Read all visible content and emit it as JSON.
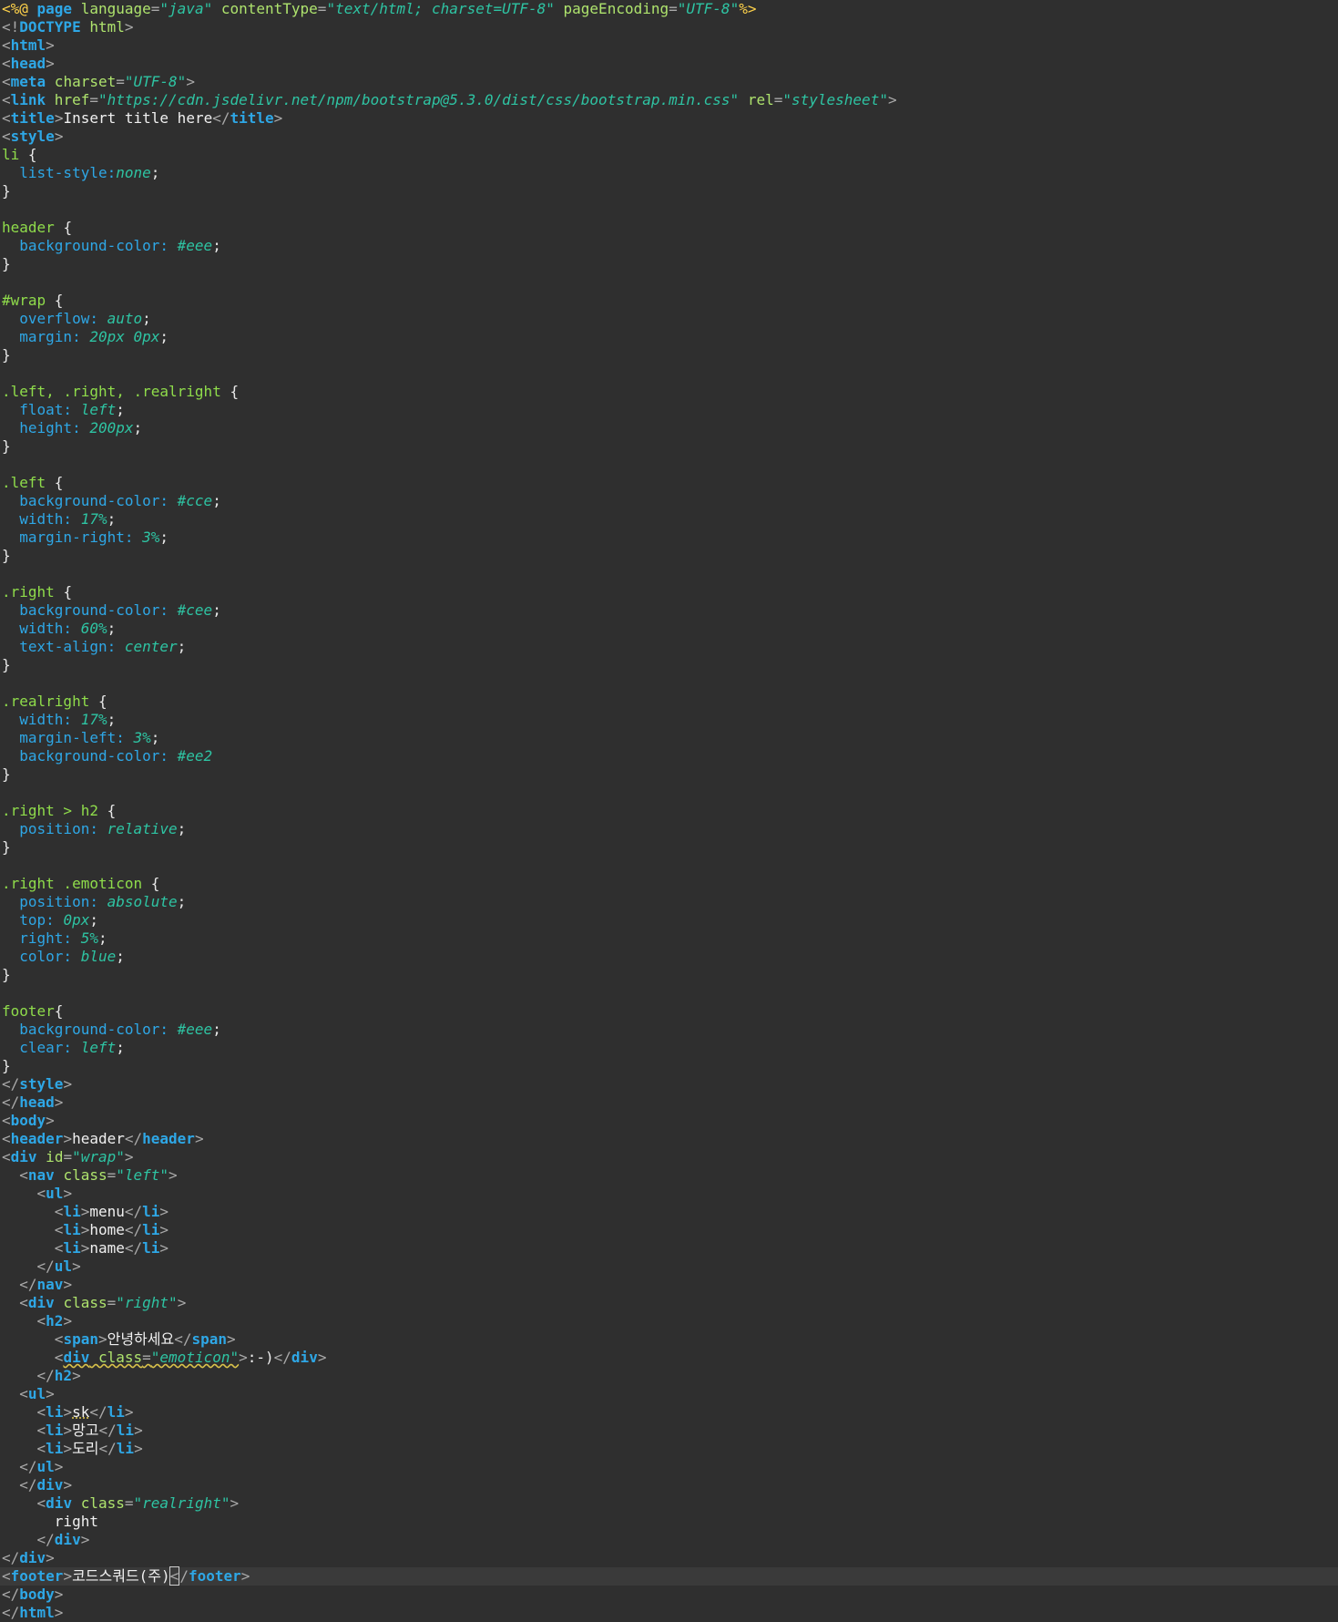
{
  "editor": {
    "colors": {
      "background": "#2f2f2f",
      "current_line": "#3a3a3a",
      "tag": "#2ea7e6",
      "attribute": "#aee36d",
      "string": "#2ec4a3",
      "directive": "#ffd24a",
      "selector": "#8fdc4b",
      "text": "#e8e8e8"
    },
    "current_line_index": 86,
    "lines": [
      [
        [
          "dir",
          "<%@ "
        ],
        [
          "tag",
          "page"
        ],
        [
          "attr",
          " language"
        ],
        [
          "punct",
          "="
        ],
        [
          "str",
          "\"java\""
        ],
        [
          "attr",
          " contentType"
        ],
        [
          "punct",
          "="
        ],
        [
          "str",
          "\"text/html; charset=UTF-8\""
        ],
        [
          "attr",
          " pageEncoding"
        ],
        [
          "punct",
          "="
        ],
        [
          "str",
          "\"UTF-8\""
        ],
        [
          "dir",
          "%>"
        ]
      ],
      [
        [
          "punct",
          "<!"
        ],
        [
          "tag",
          "DOCTYPE"
        ],
        [
          "attr",
          " html"
        ],
        [
          "punct",
          ">"
        ]
      ],
      [
        [
          "punct",
          "<"
        ],
        [
          "tag",
          "html"
        ],
        [
          "punct",
          ">"
        ]
      ],
      [
        [
          "punct",
          "<"
        ],
        [
          "tag",
          "head"
        ],
        [
          "punct",
          ">"
        ]
      ],
      [
        [
          "punct",
          "<"
        ],
        [
          "tag",
          "meta"
        ],
        [
          "attr",
          " charset"
        ],
        [
          "punct",
          "="
        ],
        [
          "str",
          "\"UTF-8\""
        ],
        [
          "punct",
          ">"
        ]
      ],
      [
        [
          "punct",
          "<"
        ],
        [
          "tag",
          "link"
        ],
        [
          "attr",
          " href"
        ],
        [
          "punct",
          "="
        ],
        [
          "str",
          "\"https://cdn.jsdelivr.net/npm/bootstrap@5.3.0/dist/css/bootstrap.min.css\""
        ],
        [
          "attr",
          " rel"
        ],
        [
          "punct",
          "="
        ],
        [
          "str",
          "\"stylesheet\""
        ],
        [
          "punct",
          ">"
        ]
      ],
      [
        [
          "punct",
          "<"
        ],
        [
          "tag",
          "title"
        ],
        [
          "punct",
          ">"
        ],
        [
          "text",
          "Insert title here"
        ],
        [
          "punct",
          "</"
        ],
        [
          "tag",
          "title"
        ],
        [
          "punct",
          ">"
        ]
      ],
      [
        [
          "punct",
          "<"
        ],
        [
          "tag",
          "style"
        ],
        [
          "punct",
          ">"
        ]
      ],
      [
        [
          "selector",
          "li "
        ],
        [
          "brace",
          "{"
        ]
      ],
      [
        [
          "cssprop",
          "  list-style:"
        ],
        [
          "cssval",
          "none"
        ],
        [
          "plain",
          ";"
        ]
      ],
      [
        [
          "brace",
          "}"
        ]
      ],
      [],
      [
        [
          "selector",
          "header "
        ],
        [
          "brace",
          "{"
        ]
      ],
      [
        [
          "cssprop",
          "  background-color: "
        ],
        [
          "cssval",
          "#eee"
        ],
        [
          "plain",
          ";"
        ]
      ],
      [
        [
          "brace",
          "}"
        ]
      ],
      [],
      [
        [
          "selector",
          "#wrap "
        ],
        [
          "brace",
          "{"
        ]
      ],
      [
        [
          "cssprop",
          "  overflow: "
        ],
        [
          "cssval",
          "auto"
        ],
        [
          "plain",
          ";"
        ]
      ],
      [
        [
          "cssprop",
          "  margin: "
        ],
        [
          "cssval",
          "20px 0px"
        ],
        [
          "plain",
          ";"
        ]
      ],
      [
        [
          "brace",
          "}"
        ]
      ],
      [],
      [
        [
          "selector",
          ".left, .right, .realright "
        ],
        [
          "brace",
          "{"
        ]
      ],
      [
        [
          "cssprop",
          "  float: "
        ],
        [
          "cssval",
          "left"
        ],
        [
          "plain",
          ";"
        ]
      ],
      [
        [
          "cssprop",
          "  height: "
        ],
        [
          "cssval",
          "200px"
        ],
        [
          "plain",
          ";"
        ]
      ],
      [
        [
          "brace",
          "}"
        ]
      ],
      [],
      [
        [
          "selector",
          ".left "
        ],
        [
          "brace",
          "{"
        ]
      ],
      [
        [
          "cssprop",
          "  background-color: "
        ],
        [
          "cssval",
          "#cce"
        ],
        [
          "plain",
          ";"
        ]
      ],
      [
        [
          "cssprop",
          "  width: "
        ],
        [
          "cssval",
          "17%"
        ],
        [
          "plain",
          ";"
        ]
      ],
      [
        [
          "cssprop",
          "  margin-right: "
        ],
        [
          "cssval",
          "3%"
        ],
        [
          "plain",
          ";"
        ]
      ],
      [
        [
          "brace",
          "}"
        ]
      ],
      [],
      [
        [
          "selector",
          ".right "
        ],
        [
          "brace",
          "{"
        ]
      ],
      [
        [
          "cssprop",
          "  background-color: "
        ],
        [
          "cssval",
          "#cee"
        ],
        [
          "plain",
          ";"
        ]
      ],
      [
        [
          "cssprop",
          "  width: "
        ],
        [
          "cssval",
          "60%"
        ],
        [
          "plain",
          ";"
        ]
      ],
      [
        [
          "cssprop",
          "  text-align: "
        ],
        [
          "cssval",
          "center"
        ],
        [
          "plain",
          ";"
        ]
      ],
      [
        [
          "brace",
          "}"
        ]
      ],
      [],
      [
        [
          "selector",
          ".realright "
        ],
        [
          "brace",
          "{"
        ]
      ],
      [
        [
          "cssprop",
          "  width: "
        ],
        [
          "cssval",
          "17%"
        ],
        [
          "plain",
          ";"
        ]
      ],
      [
        [
          "cssprop",
          "  margin-left: "
        ],
        [
          "cssval",
          "3%"
        ],
        [
          "plain",
          ";"
        ]
      ],
      [
        [
          "cssprop",
          "  background-color: "
        ],
        [
          "cssval",
          "#ee2"
        ]
      ],
      [
        [
          "brace",
          "}"
        ]
      ],
      [],
      [
        [
          "selector",
          ".right > h2 "
        ],
        [
          "brace",
          "{"
        ]
      ],
      [
        [
          "cssprop",
          "  position: "
        ],
        [
          "cssval",
          "relative"
        ],
        [
          "plain",
          ";"
        ]
      ],
      [
        [
          "brace",
          "}"
        ]
      ],
      [],
      [
        [
          "selector",
          ".right .emoticon "
        ],
        [
          "brace",
          "{"
        ]
      ],
      [
        [
          "cssprop",
          "  position: "
        ],
        [
          "cssval",
          "absolute"
        ],
        [
          "plain",
          ";"
        ]
      ],
      [
        [
          "cssprop",
          "  top: "
        ],
        [
          "cssval",
          "0px"
        ],
        [
          "plain",
          ";"
        ]
      ],
      [
        [
          "cssprop",
          "  right: "
        ],
        [
          "cssval",
          "5%"
        ],
        [
          "plain",
          ";"
        ]
      ],
      [
        [
          "cssprop",
          "  color: "
        ],
        [
          "cssval",
          "blue"
        ],
        [
          "plain",
          ";"
        ]
      ],
      [
        [
          "brace",
          "}"
        ]
      ],
      [],
      [
        [
          "selector",
          "footer"
        ],
        [
          "brace",
          "{"
        ]
      ],
      [
        [
          "cssprop",
          "  background-color: "
        ],
        [
          "cssval",
          "#eee"
        ],
        [
          "plain",
          ";"
        ]
      ],
      [
        [
          "cssprop",
          "  clear: "
        ],
        [
          "cssval",
          "left"
        ],
        [
          "plain",
          ";"
        ]
      ],
      [
        [
          "brace",
          "}"
        ]
      ],
      [
        [
          "punct",
          "</"
        ],
        [
          "tag",
          "style"
        ],
        [
          "punct",
          ">"
        ]
      ],
      [
        [
          "punct",
          "</"
        ],
        [
          "tag",
          "head"
        ],
        [
          "punct",
          ">"
        ]
      ],
      [
        [
          "punct",
          "<"
        ],
        [
          "tag",
          "body"
        ],
        [
          "punct",
          ">"
        ]
      ],
      [
        [
          "punct",
          "<"
        ],
        [
          "tag",
          "header"
        ],
        [
          "punct",
          ">"
        ],
        [
          "text",
          "header"
        ],
        [
          "punct",
          "</"
        ],
        [
          "tag",
          "header"
        ],
        [
          "punct",
          ">"
        ]
      ],
      [
        [
          "punct",
          "<"
        ],
        [
          "tag",
          "div"
        ],
        [
          "attr",
          " id"
        ],
        [
          "punct",
          "="
        ],
        [
          "str",
          "\"wrap\""
        ],
        [
          "punct",
          ">"
        ]
      ],
      [
        [
          "plain",
          "  "
        ],
        [
          "punct",
          "<"
        ],
        [
          "tag",
          "nav"
        ],
        [
          "attr",
          " class"
        ],
        [
          "punct",
          "="
        ],
        [
          "str",
          "\"left\""
        ],
        [
          "punct",
          ">"
        ]
      ],
      [
        [
          "plain",
          "    "
        ],
        [
          "punct",
          "<"
        ],
        [
          "tag",
          "ul"
        ],
        [
          "punct",
          ">"
        ]
      ],
      [
        [
          "plain",
          "      "
        ],
        [
          "punct",
          "<"
        ],
        [
          "tag",
          "li"
        ],
        [
          "punct",
          ">"
        ],
        [
          "text",
          "menu"
        ],
        [
          "punct",
          "</"
        ],
        [
          "tag",
          "li"
        ],
        [
          "punct",
          ">"
        ]
      ],
      [
        [
          "plain",
          "      "
        ],
        [
          "punct",
          "<"
        ],
        [
          "tag",
          "li"
        ],
        [
          "punct",
          ">"
        ],
        [
          "text",
          "home"
        ],
        [
          "punct",
          "</"
        ],
        [
          "tag",
          "li"
        ],
        [
          "punct",
          ">"
        ]
      ],
      [
        [
          "plain",
          "      "
        ],
        [
          "punct",
          "<"
        ],
        [
          "tag",
          "li"
        ],
        [
          "punct",
          ">"
        ],
        [
          "text",
          "name"
        ],
        [
          "punct",
          "</"
        ],
        [
          "tag",
          "li"
        ],
        [
          "punct",
          ">"
        ]
      ],
      [
        [
          "plain",
          "    "
        ],
        [
          "punct",
          "</"
        ],
        [
          "tag",
          "ul"
        ],
        [
          "punct",
          ">"
        ]
      ],
      [
        [
          "plain",
          "  "
        ],
        [
          "punct",
          "</"
        ],
        [
          "tag",
          "nav"
        ],
        [
          "punct",
          ">"
        ]
      ],
      [
        [
          "plain",
          "  "
        ],
        [
          "punct",
          "<"
        ],
        [
          "tag",
          "div"
        ],
        [
          "attr",
          " class"
        ],
        [
          "punct",
          "="
        ],
        [
          "str",
          "\"right\""
        ],
        [
          "punct",
          ">"
        ]
      ],
      [
        [
          "plain",
          "    "
        ],
        [
          "punct",
          "<"
        ],
        [
          "tag",
          "h2"
        ],
        [
          "punct",
          ">"
        ]
      ],
      [
        [
          "plain",
          "      "
        ],
        [
          "punct",
          "<"
        ],
        [
          "tag",
          "span"
        ],
        [
          "punct",
          ">"
        ],
        [
          "text",
          "안녕하세요"
        ],
        [
          "punct",
          "</"
        ],
        [
          "tag",
          "span"
        ],
        [
          "punct",
          ">"
        ]
      ],
      [
        [
          "plain",
          "      "
        ],
        [
          "punct",
          "<"
        ],
        [
          "tag",
          "div",
          "squiggle"
        ],
        [
          "attr",
          " class",
          "squiggle"
        ],
        [
          "punct",
          "=",
          "squiggle"
        ],
        [
          "str",
          "\"emoticon\"",
          "squiggle"
        ],
        [
          "punct",
          ">"
        ],
        [
          "text",
          ":-)"
        ],
        [
          "punct",
          "</"
        ],
        [
          "tag",
          "div"
        ],
        [
          "punct",
          ">"
        ]
      ],
      [
        [
          "plain",
          "    "
        ],
        [
          "punct",
          "</"
        ],
        [
          "tag",
          "h2"
        ],
        [
          "punct",
          ">"
        ]
      ],
      [
        [
          "plain",
          "  "
        ],
        [
          "punct",
          "<"
        ],
        [
          "tag",
          "ul"
        ],
        [
          "punct",
          ">"
        ]
      ],
      [
        [
          "plain",
          "    "
        ],
        [
          "punct",
          "<"
        ],
        [
          "tag",
          "li"
        ],
        [
          "punct",
          ">"
        ],
        [
          "text",
          "sk",
          "dotted"
        ],
        [
          "punct",
          "</"
        ],
        [
          "tag",
          "li"
        ],
        [
          "punct",
          ">"
        ]
      ],
      [
        [
          "plain",
          "    "
        ],
        [
          "punct",
          "<"
        ],
        [
          "tag",
          "li"
        ],
        [
          "punct",
          ">"
        ],
        [
          "text",
          "망고"
        ],
        [
          "punct",
          "</"
        ],
        [
          "tag",
          "li"
        ],
        [
          "punct",
          ">"
        ]
      ],
      [
        [
          "plain",
          "    "
        ],
        [
          "punct",
          "<"
        ],
        [
          "tag",
          "li"
        ],
        [
          "punct",
          ">"
        ],
        [
          "text",
          "도리"
        ],
        [
          "punct",
          "</"
        ],
        [
          "tag",
          "li"
        ],
        [
          "punct",
          ">"
        ]
      ],
      [
        [
          "plain",
          "  "
        ],
        [
          "punct",
          "</"
        ],
        [
          "tag",
          "ul"
        ],
        [
          "punct",
          ">"
        ]
      ],
      [
        [
          "plain",
          "  "
        ],
        [
          "punct",
          "</"
        ],
        [
          "tag",
          "div"
        ],
        [
          "punct",
          ">"
        ]
      ],
      [
        [
          "plain",
          "    "
        ],
        [
          "punct",
          "<"
        ],
        [
          "tag",
          "div"
        ],
        [
          "attr",
          " class"
        ],
        [
          "punct",
          "="
        ],
        [
          "str",
          "\"realright\""
        ],
        [
          "punct",
          ">"
        ]
      ],
      [
        [
          "plain",
          "      "
        ],
        [
          "text",
          "right"
        ]
      ],
      [
        [
          "plain",
          "    "
        ],
        [
          "punct",
          "</"
        ],
        [
          "tag",
          "div"
        ],
        [
          "punct",
          ">"
        ]
      ],
      [
        [
          "punct",
          "</"
        ],
        [
          "tag",
          "div"
        ],
        [
          "punct",
          ">"
        ]
      ],
      [
        [
          "punct",
          "<"
        ],
        [
          "tag",
          "footer"
        ],
        [
          "punct",
          ">"
        ],
        [
          "text",
          "코드스쿼드(주)"
        ],
        [
          "punct",
          "<",
          "bracket-box"
        ],
        [
          "caret",
          ""
        ],
        [
          "punct",
          "/"
        ],
        [
          "tag",
          "footer"
        ],
        [
          "punct",
          ">"
        ]
      ],
      [
        [
          "punct",
          "</"
        ],
        [
          "tag",
          "body"
        ],
        [
          "punct",
          ">"
        ]
      ],
      [
        [
          "punct",
          "</"
        ],
        [
          "tag",
          "html"
        ],
        [
          "punct",
          ">"
        ]
      ]
    ]
  }
}
